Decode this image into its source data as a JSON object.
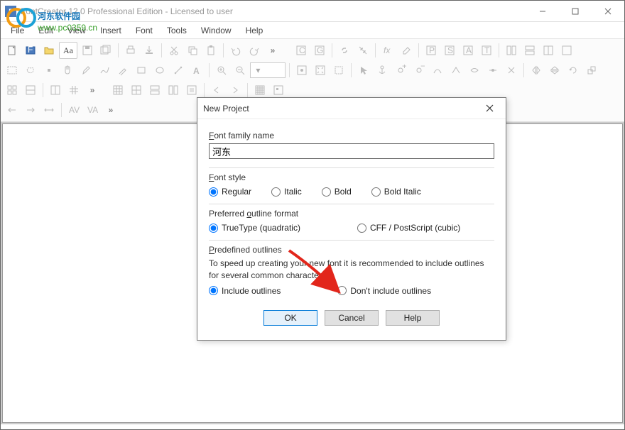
{
  "window": {
    "title": "FontCreator 12.0 Professional Edition - Licensed to user"
  },
  "watermark": {
    "line1": "河东软件园",
    "line2": "www.pc0359.cn"
  },
  "menu": {
    "items": [
      "File",
      "Edit",
      "View",
      "Insert",
      "Font",
      "Tools",
      "Window",
      "Help"
    ]
  },
  "toolbar": {
    "sample_glyph": "Aa",
    "overflow": "»"
  },
  "dialog": {
    "title": "New Project",
    "font_family_label": "Font family name",
    "font_family_value": "河东",
    "font_style_label": "Font style",
    "style_regular": "Regular",
    "style_italic": "Italic",
    "style_bold": "Bold",
    "style_bolditalic": "Bold Italic",
    "outline_format_label": "Preferred outline format",
    "fmt_truetype": "TrueType (quadratic)",
    "fmt_cff": "CFF / PostScript (cubic)",
    "predef_label": "Predefined outlines",
    "predef_desc": "To speed up creating your new font it is recommended to include outlines for several common characters.",
    "include_outlines": "Include outlines",
    "dont_include": "Don't include outlines",
    "ok": "OK",
    "cancel": "Cancel",
    "help": "Help"
  }
}
